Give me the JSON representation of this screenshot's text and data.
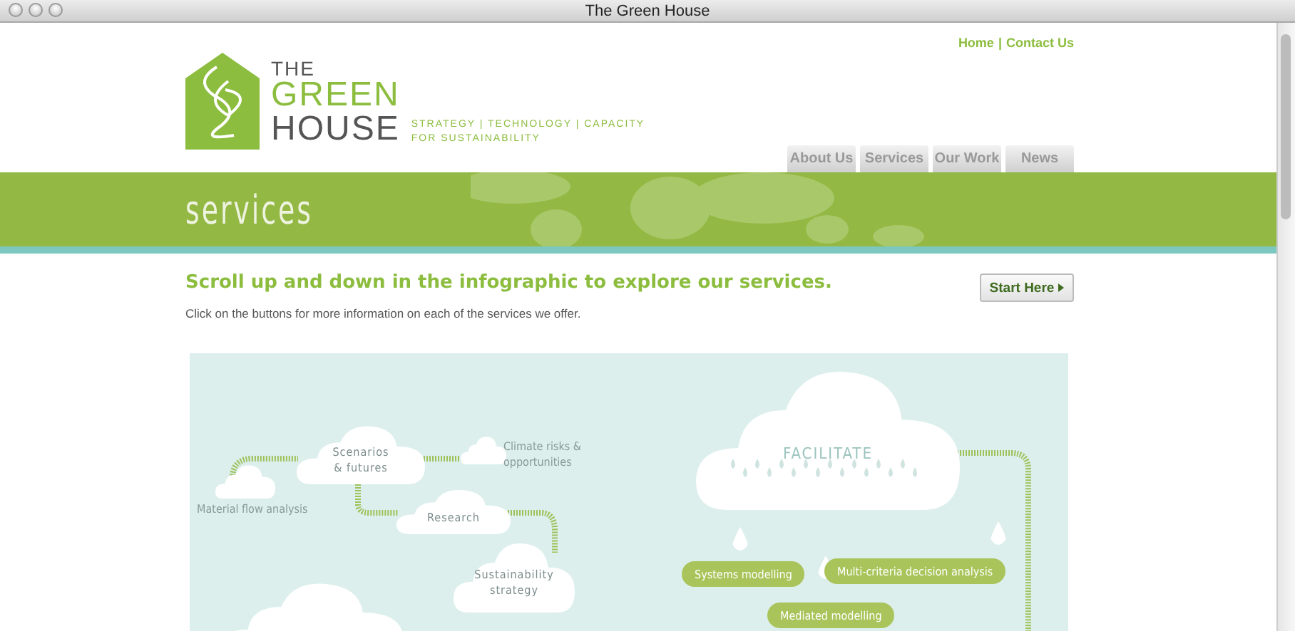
{
  "window": {
    "title": "The Green House"
  },
  "top_links": [
    "Home",
    "Contact Us"
  ],
  "top_link_separator": "|",
  "logo": {
    "the": "THE",
    "green": "GREEN",
    "house": "HOUSE",
    "tagline": [
      "STRATEGY | TECHNOLOGY | CAPACITY",
      "FOR SUSTAINABILITY"
    ]
  },
  "nav": [
    "About Us",
    "Services",
    "Our Work",
    "News"
  ],
  "banner": {
    "title": "services"
  },
  "intro": {
    "heading": "Scroll up and down in the infographic to explore our services.",
    "text": "Click on the buttons for more information on each of the services we offer.",
    "button": "Start Here"
  },
  "infographic": {
    "clouds": [
      {
        "kind": "labelled",
        "lines": [
          "Scenarios",
          "& futures"
        ]
      },
      {
        "kind": "labelled",
        "lines": [
          "Research"
        ]
      },
      {
        "kind": "labelled",
        "lines": [
          "Sustainability",
          "strategy"
        ]
      },
      {
        "kind": "captioned",
        "lines": [
          "Material flow analysis"
        ]
      },
      {
        "kind": "captioned",
        "lines": [
          "Climate risks &",
          "opportunities"
        ]
      },
      {
        "kind": "big",
        "lines": [
          "FACILITATE"
        ]
      }
    ],
    "pills": [
      "Systems modelling",
      "Multi-criteria decision analysis",
      "Mediated modelling"
    ]
  }
}
